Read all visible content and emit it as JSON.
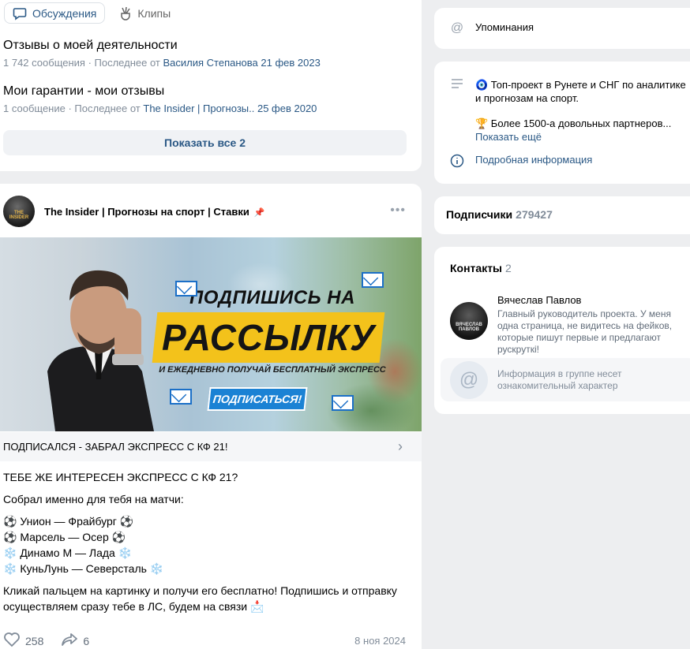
{
  "tabs": [
    {
      "label": "Обсуждения",
      "icon": "chat-icon",
      "active": true
    },
    {
      "label": "Клипы",
      "icon": "clips-icon",
      "active": false
    }
  ],
  "topics": [
    {
      "title": "Отзывы о моей деятельности",
      "count": "1 742 сообщения",
      "sep": " · Последнее от ",
      "author": "Василия Степанова",
      "date": "21 фев 2023"
    },
    {
      "title": "Мои гарантии - мои отзывы",
      "count": "1 сообщение",
      "sep": " · Последнее от ",
      "author": "The Insider | Прогнозы..",
      "date": "25 фев 2020"
    }
  ],
  "show_all": "Показать все 2",
  "post": {
    "author": "The Insider | Прогнозы на спорт | Ставки",
    "avatar_text": "THE INSIDER",
    "banner": {
      "headline": "ПОДПИШИСЬ НА",
      "big": "РАССЫЛКУ",
      "sub": "И ЕЖЕДНЕВНО ПОЛУЧАЙ БЕСПЛАТНЫЙ ЭКСПРЕСС",
      "button": "ПОДПИСАТЬСЯ!"
    },
    "link_title": "ПОДПИСАЛСЯ - ЗАБРАЛ ЭКСПРЕСС С КФ 21!",
    "lines": {
      "l1": "ТЕБЕ ЖЕ ИНТЕРЕСЕН ЭКСПРЕСС С КФ 21?",
      "l2": "Собрал именно для тебя на матчи:",
      "m1": "⚽ Унион — Фрайбург ⚽",
      "m2": "⚽ Марсель — Осер ⚽",
      "m3": "❄️ Динамо М — Лада ❄️",
      "m4": "❄️ КуньЛунь — Северсталь ❄️",
      "l3": "Кликай пальцем на картинку и получи его бесплатно! Подпишись и отправку осуществляем сразу тебе в ЛС, будем на связи 📩"
    },
    "likes": "258",
    "shares": "6",
    "date": "8 ноя 2024"
  },
  "sidebar": {
    "mentions": "Упоминания",
    "info_1": "🧿 Топ-проект в Рунете и СНГ по аналитике и прогнозам на спорт.",
    "info_2": "🏆 Более 1500-а довольных партнеров...",
    "show_more": "Показать ещё",
    "details": "Подробная информация",
    "subscribers_label": "Подписчики",
    "subscribers_count": "279427",
    "contacts_label": "Контакты",
    "contacts_count": "2",
    "contact_name": "Вячеслав Павлов",
    "contact_desc": "Главный руководитель проекта. У меня одна страница, не видитесь на фейков, которые пишут первые и предлагают рускруткі!",
    "contact_avatar_text": "ВЯЧЕСЛАВ ПАВЛОВ",
    "notice": "Информация в группе несет ознакомительный характер"
  },
  "colors": {
    "link": "#2a5885",
    "muted": "#818c99",
    "background": "#edeef0",
    "banner_yellow": "#f3c21b",
    "banner_blue": "#1b82d4"
  }
}
